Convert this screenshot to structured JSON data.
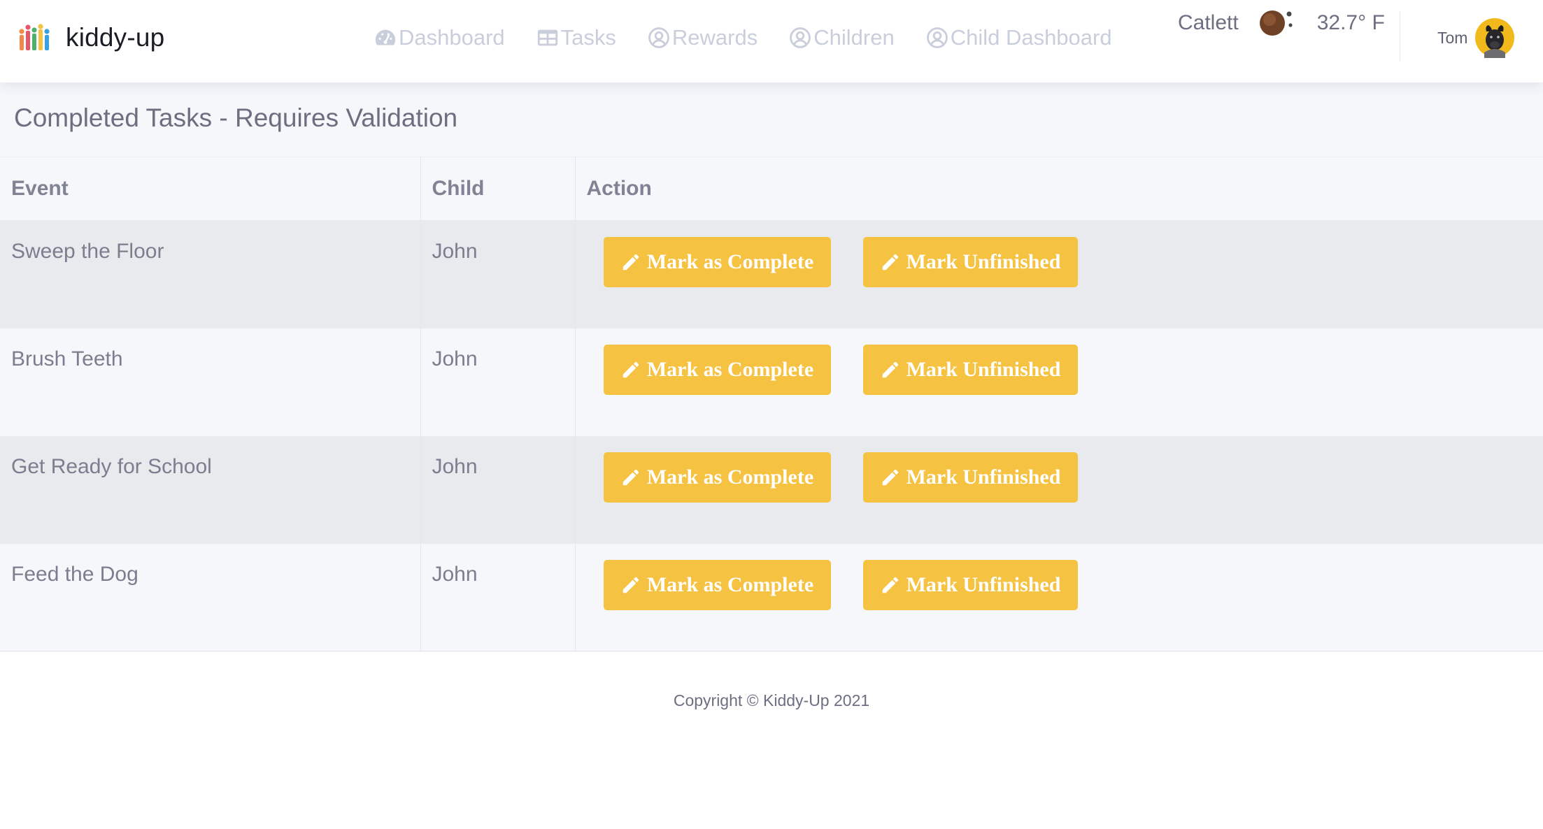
{
  "brand": {
    "name": "kiddy-up",
    "logo_icon": "kiddy-up-logo-icon",
    "colors": [
      "#f08a4b",
      "#e8566c",
      "#4fb06d",
      "#f5c242",
      "#3aa0e0"
    ]
  },
  "nav": {
    "items": [
      {
        "label": "Dashboard",
        "icon": "speedometer-icon"
      },
      {
        "label": "Tasks",
        "icon": "table-icon"
      },
      {
        "label": "Rewards",
        "icon": "user-circle-icon"
      },
      {
        "label": "Children",
        "icon": "user-circle-icon"
      },
      {
        "label": "Child Dashboard",
        "icon": "user-circle-icon"
      }
    ]
  },
  "weather": {
    "location": "Catlett",
    "icon": "weather-icon",
    "temperature": "32.7° F"
  },
  "user": {
    "name": "Tom",
    "avatar_icon": "dog-avatar-icon"
  },
  "page": {
    "title": "Completed Tasks - Requires Validation"
  },
  "table": {
    "headers": {
      "event": "Event",
      "child": "Child",
      "action": "Action"
    },
    "rows": [
      {
        "event": "Sweep the Floor",
        "child": "John",
        "complete_label": "Mark as Complete",
        "unfinished_label": "Mark Unfinished"
      },
      {
        "event": "Brush Teeth",
        "child": "John",
        "complete_label": "Mark as Complete",
        "unfinished_label": "Mark Unfinished"
      },
      {
        "event": "Get Ready for School",
        "child": "John",
        "complete_label": "Mark as Complete",
        "unfinished_label": "Mark Unfinished"
      },
      {
        "event": "Feed the Dog",
        "child": "John",
        "complete_label": "Mark as Complete",
        "unfinished_label": "Mark Unfinished"
      }
    ]
  },
  "colors": {
    "button_background": "#f5c242",
    "button_text": "#ffffff",
    "nav_text": "#c9cedb",
    "page_background": "#f6f7fb",
    "row_stripe": "#e9eaee"
  },
  "footer": {
    "copyright": "Copyright © Kiddy-Up 2021"
  }
}
